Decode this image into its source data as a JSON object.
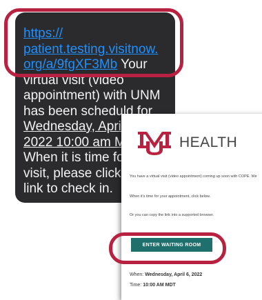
{
  "sms": {
    "link_line1": "https://",
    "link_line2": "patient.testing.visitnow.",
    "link_line3": "org/a/9fgXF3Mb",
    "after_link": " Your",
    "line4": "virtual visit (video",
    "line5": "appointment) with UNM",
    "line6": "has been schedul",
    "line6_rest": "d for",
    "line7": "Wednesday, April",
    "line8": "2022 10:00 am M",
    "line9": "When it is time for",
    "line10": "visit, please click o",
    "line11": "link to check in."
  },
  "email": {
    "logo_text": "HEALTH",
    "intro": "You have a virtual visit (video appointment) coming up soon with COPE. We",
    "instruction": "When it's time for your appointment, click below.",
    "copy_note": "Or you can copy the link into a supported browser.",
    "button_label": "ENTER WAITING ROOM",
    "when_label": "When:",
    "when_value": "Wednesday, April 6, 2022",
    "time_label": "Time:",
    "time_value": "10:00 AM MDT"
  },
  "colors": {
    "highlight": "#b8213f",
    "button": "#1f6f6c",
    "link": "#1e90ff",
    "sms_bg": "#2b2b2d",
    "logo": "#b8213f"
  }
}
